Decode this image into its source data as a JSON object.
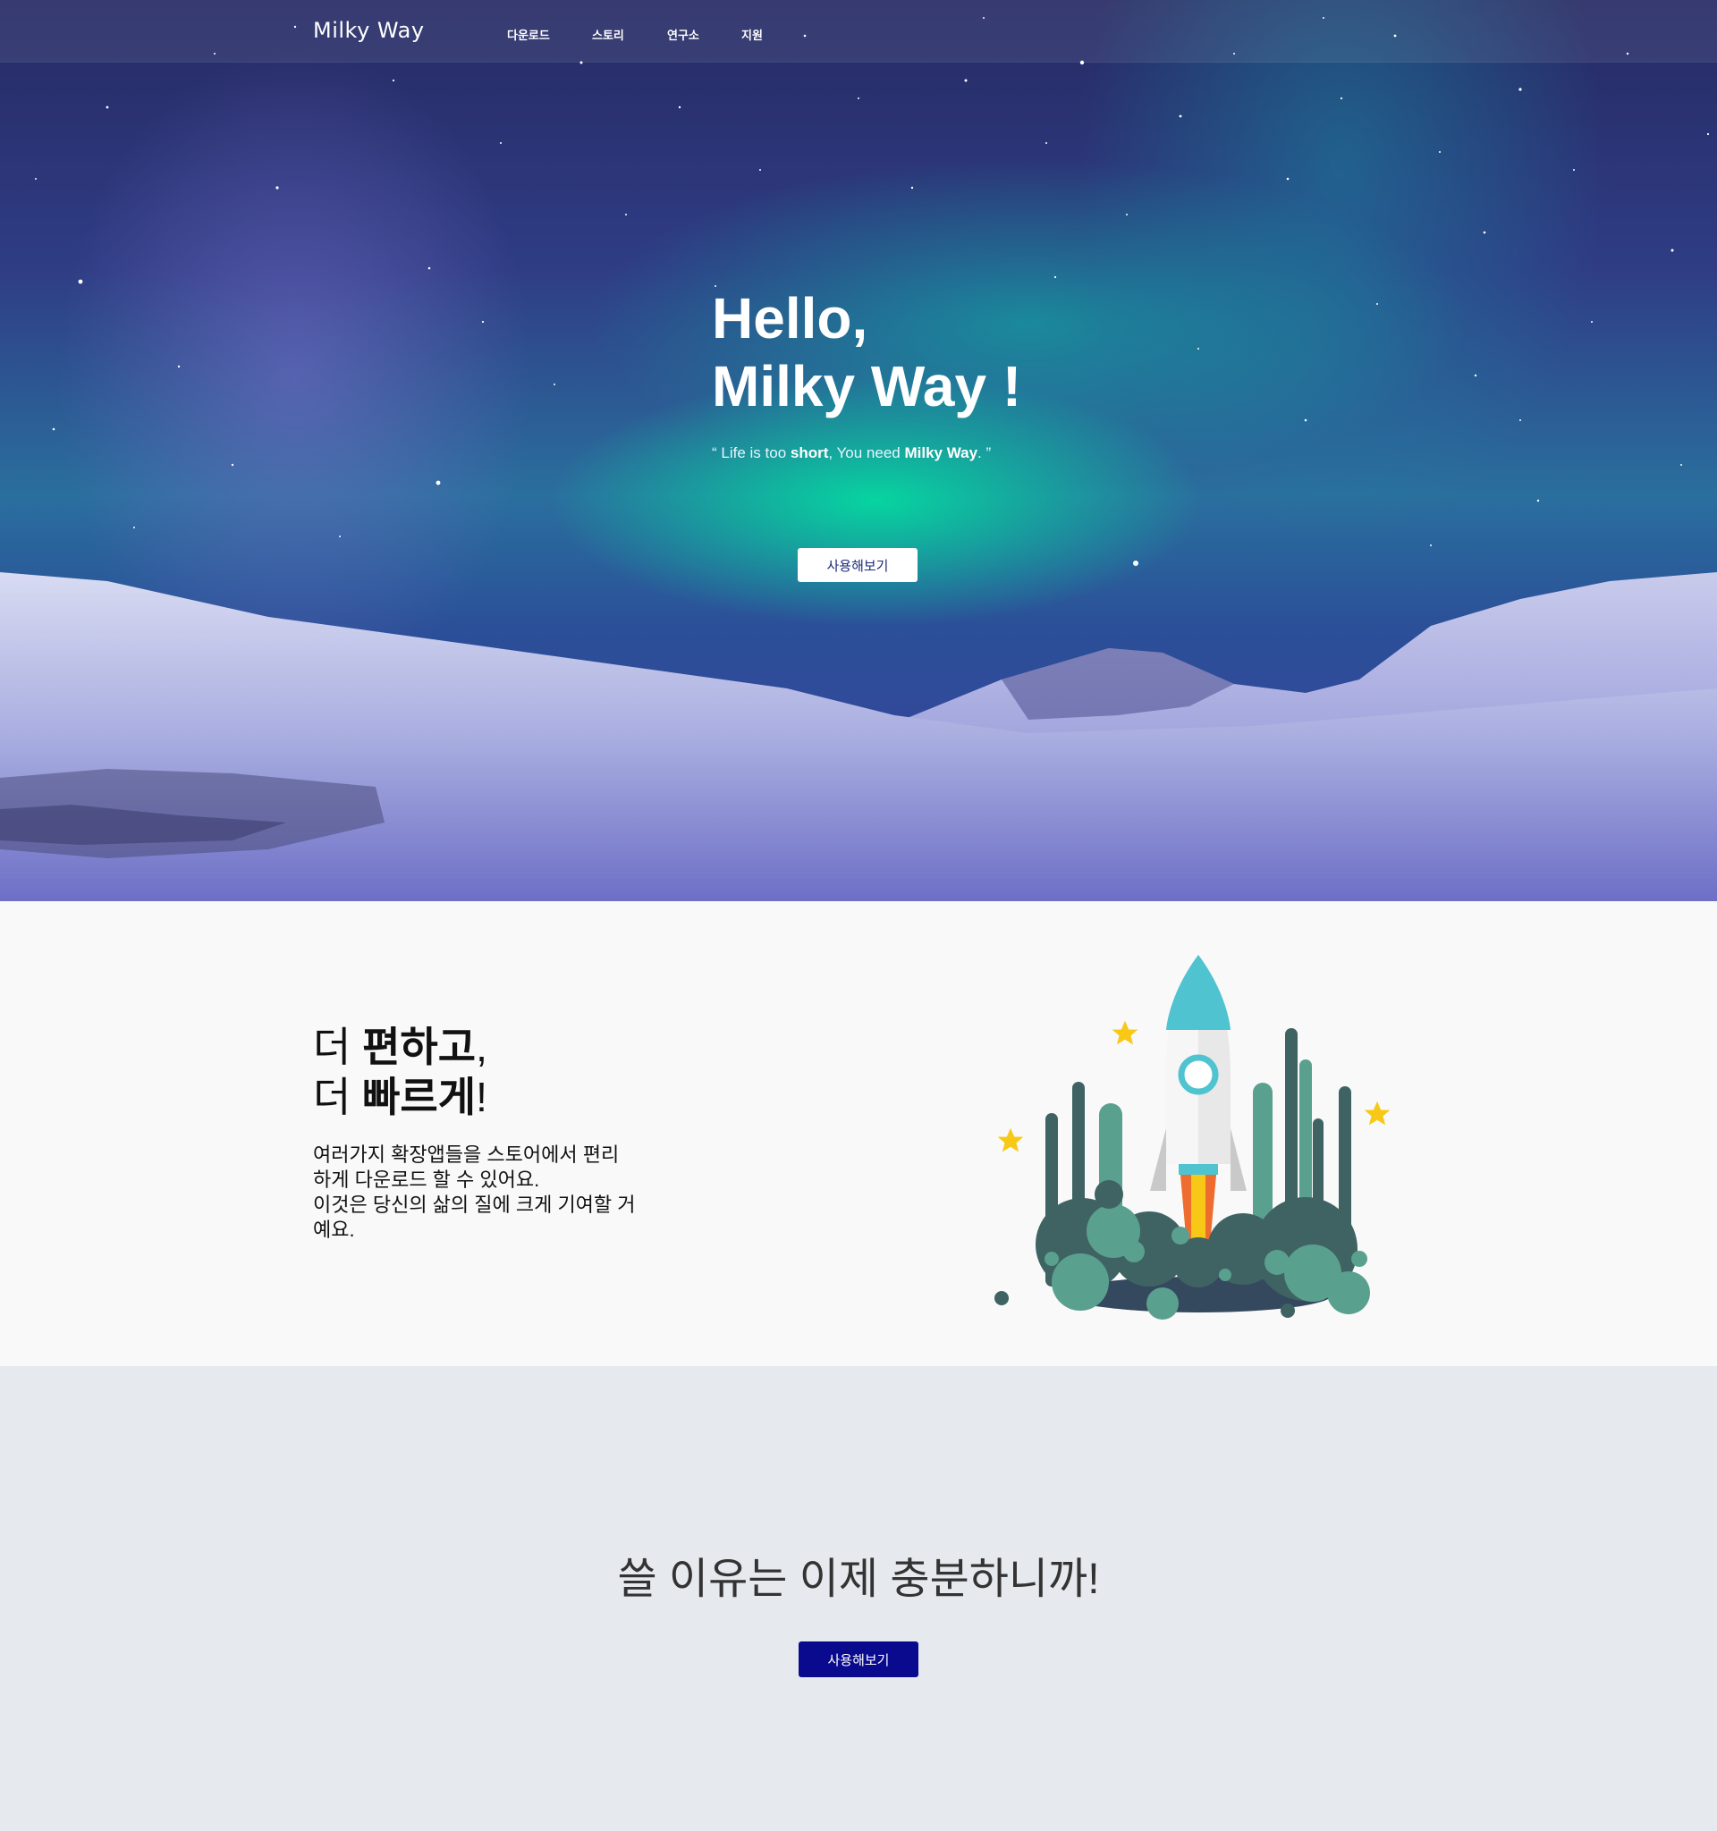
{
  "header": {
    "logo": "Milky Way",
    "nav": [
      "다운로드",
      "스토리",
      "연구소",
      "지원"
    ]
  },
  "hero": {
    "title_line1": "Hello,",
    "title_line2": "Milky Way !",
    "subtitle": {
      "open_quote": "“ Life is too ",
      "strong1": "short",
      "middle": ", You need ",
      "strong2": "Milky Way",
      "close_quote": ". ”"
    },
    "button": "사용해보기"
  },
  "feature": {
    "title_line1_plain": "더 ",
    "title_line1_bold": "편하고",
    "title_line1_end": ",",
    "title_line2_plain": "더 ",
    "title_line2_bold": "빠르게",
    "title_line2_end": "!",
    "description": "여러가지 확장앱들을 스토어에서 편리하게 다운로드 할 수 있어요. 이것은 당신의 삶의 질에 크게 기여할 거예요.",
    "description_line1": "여러가지 확장앱들을 스토어에서 편리",
    "description_line2": "하게 다운로드 할 수 있어요.",
    "description_line3": "이것은 당신의 삶의 질에 크게 기여할 거",
    "description_line4": "예요."
  },
  "cta": {
    "title": "쓸 이유는 이제 충분하니까!",
    "button": "사용해보기"
  },
  "colors": {
    "hero_sky_top": "#262a63",
    "aurora_green": "#00e6a0",
    "feature_bg": "#f9f9f9",
    "cta_bg": "#e6eaee",
    "cta_button": "#0a0a8f",
    "rocket_teal": "#4fc3cf",
    "forest_dark": "#3f6363",
    "forest_green": "#5aa08e",
    "star_yellow": "#f7c916"
  },
  "icons": [
    "rocket-illustration",
    "star-icon"
  ]
}
